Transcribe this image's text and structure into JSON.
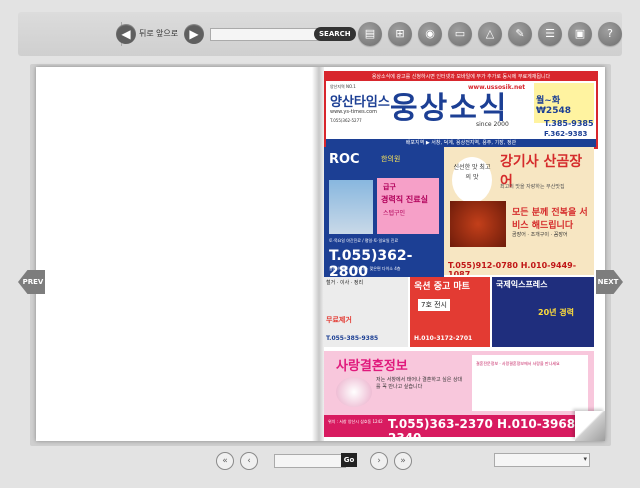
{
  "toolbar": {
    "back_label": "뒤로",
    "forward_label": "앞으로",
    "search_placeholder": "",
    "search_button": "SEARCH",
    "tools": [
      "doc-icon",
      "thumbnails-icon",
      "cd-icon",
      "print-icon",
      "triangle-icon",
      "pencil-icon",
      "list-icon",
      "save-icon",
      "help-icon"
    ]
  },
  "sides": {
    "prev_label": "PREV",
    "next_label": "NEXT"
  },
  "bottombar": {
    "first_icon": "«",
    "prev_icon": "‹",
    "go_label": "Go",
    "next_icon": "›",
    "last_icon": "»",
    "select_value": ""
  },
  "magazine": {
    "top_strip": "용상소식에 광고를 신청하시면 인터넷과 모바일에 무가 추가로 동시에 무료게재됩니다",
    "logo_small": "양산지역 NO.1",
    "logo_kr": "양산타임스",
    "logo_url": "www.ys-times.com",
    "logo_phone": "T.055)362-5277",
    "main_title": "웅상소식",
    "website": "www.ussosik.net",
    "since": "since 2000",
    "price": "월~화 ₩2548",
    "tel1": "T.385-9385",
    "tel2": "F.362-9383",
    "bottom_strip": "배포지역 ▶ 서창, 덕계, 용상전지역, 용주, 기장, 정관",
    "clinic_title": "ROC",
    "clinic_sub": "한의원",
    "clinic_pink_1": "급구",
    "clinic_pink_2": "경력직 진료실",
    "clinic_pink_3": "스텝구인",
    "clinic_info": "토·목요일 야간진료 / 평일·토·일요일 진료",
    "clinic_phone": "T.055)362-2800",
    "clinic_addr": "용산 이마트 트레이더스 맞은편 다이소 4층",
    "rest_slogan": "신선한 맛 최고의 맛",
    "rest_name": "강기사 산곰장어",
    "rest_desc": "최고의 맛을 자랑하는 부산맛집",
    "rest_red": "모든 분께 전복을 서비스 해드립니다",
    "rest_tags": "곰장어 · 조개구이 · 꼼장어",
    "rest_phone": "T.055)912-0780 H.010-9449-1087",
    "used_title": "옥션 중고 마트",
    "used_sub": "7호 전시",
    "used_phone": "H.010-3172-2701",
    "express_title": "국제익스프레스",
    "express_year": "20년 경력",
    "ls_title": "철거 · 이사 · 정리",
    "ls_big": "무료제거",
    "ls_phone": "T.055-385-9385",
    "wed_title": "사랑결혼정보",
    "wed_box_text": "결혼전문정보 · 사랑결혼정보에서 사랑을 만나세요",
    "wed_text": "저는 서창에서 태어나 결혼하고 싶은 상대를 꼭 만나고 싶습니다",
    "wed_addr": "위치 : 서창 양산시 삼호동 1242",
    "wed_phone": "T.055)363-2370 H.010-3968-2340"
  }
}
